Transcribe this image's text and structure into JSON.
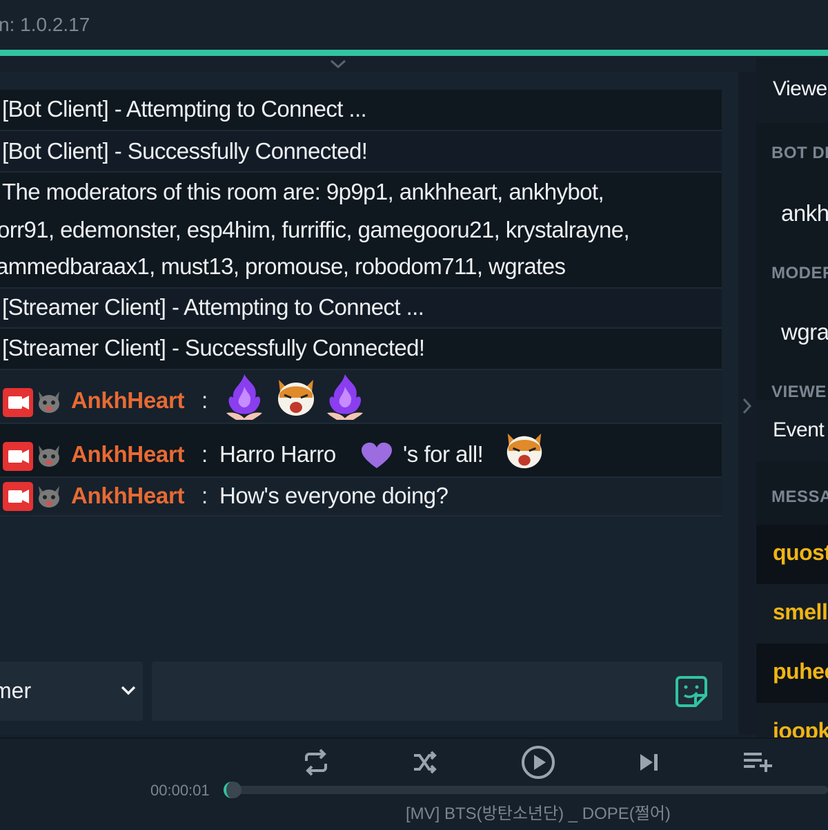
{
  "app": {
    "version_label": "n: 1.0.2.17",
    "accent_color": "#31c3a2"
  },
  "chat": {
    "system_messages": [
      {
        "text": "[Bot Client] - Attempting to Connect ..."
      },
      {
        "text": "[Bot Client] - Successfully Connected!"
      },
      {
        "lines": [
          "The moderators of this room are: 9p9p1, ankhheart, ankhybot,",
          "orr91, edemonster, esp4him, furriffic, gamegooru21, krystalrayne,",
          "ammedbaraax1, must13, promouse, robodom711, wgrates"
        ]
      },
      {
        "text": "[Streamer Client] - Attempting to Connect ..."
      },
      {
        "text": "[Streamer Client] - Successfully Connected!"
      }
    ],
    "user_messages": [
      {
        "username": "AnkhHeart",
        "separator": ":",
        "text": "",
        "emotes": [
          "purple-fire-hands-emote",
          "cat-laugh-emote",
          "purple-fire-hands-emote"
        ]
      },
      {
        "username": "AnkhHeart",
        "separator": ":",
        "text_before": "Harro Harro",
        "emote_mid": "purple-heart-emote",
        "text_after": "'s for all!",
        "emote_end": "cat-laugh-emote"
      },
      {
        "username": "AnkhHeart",
        "separator": ":",
        "text": "How's everyone doing?"
      }
    ],
    "username_color": "#e86a33",
    "badge_color": "#e53232",
    "recipient_select": {
      "value": "mer"
    },
    "input": {
      "value": "",
      "placeholder": ""
    }
  },
  "right_panel": {
    "viewers_tab": "Viewe",
    "bot_header": "BOT DE",
    "bot_name": "ankh",
    "moderators_header": "MODER",
    "moderator_name": "wgra",
    "viewers_header": "VIEWE",
    "events_tab": "Event",
    "messages_header": "MESSA",
    "message_names": [
      "quost",
      "smell",
      "puhee",
      "ioopk"
    ],
    "message_name_color": "#f0b414"
  },
  "player": {
    "time": "00:00:01",
    "progress_fraction": 0.0,
    "track_title": "[MV] BTS(방탄소년단) _ DOPE(쩔어)",
    "controls": [
      "repeat-icon",
      "shuffle-icon",
      "play-icon",
      "skip-next-icon",
      "add-to-queue-icon"
    ]
  }
}
